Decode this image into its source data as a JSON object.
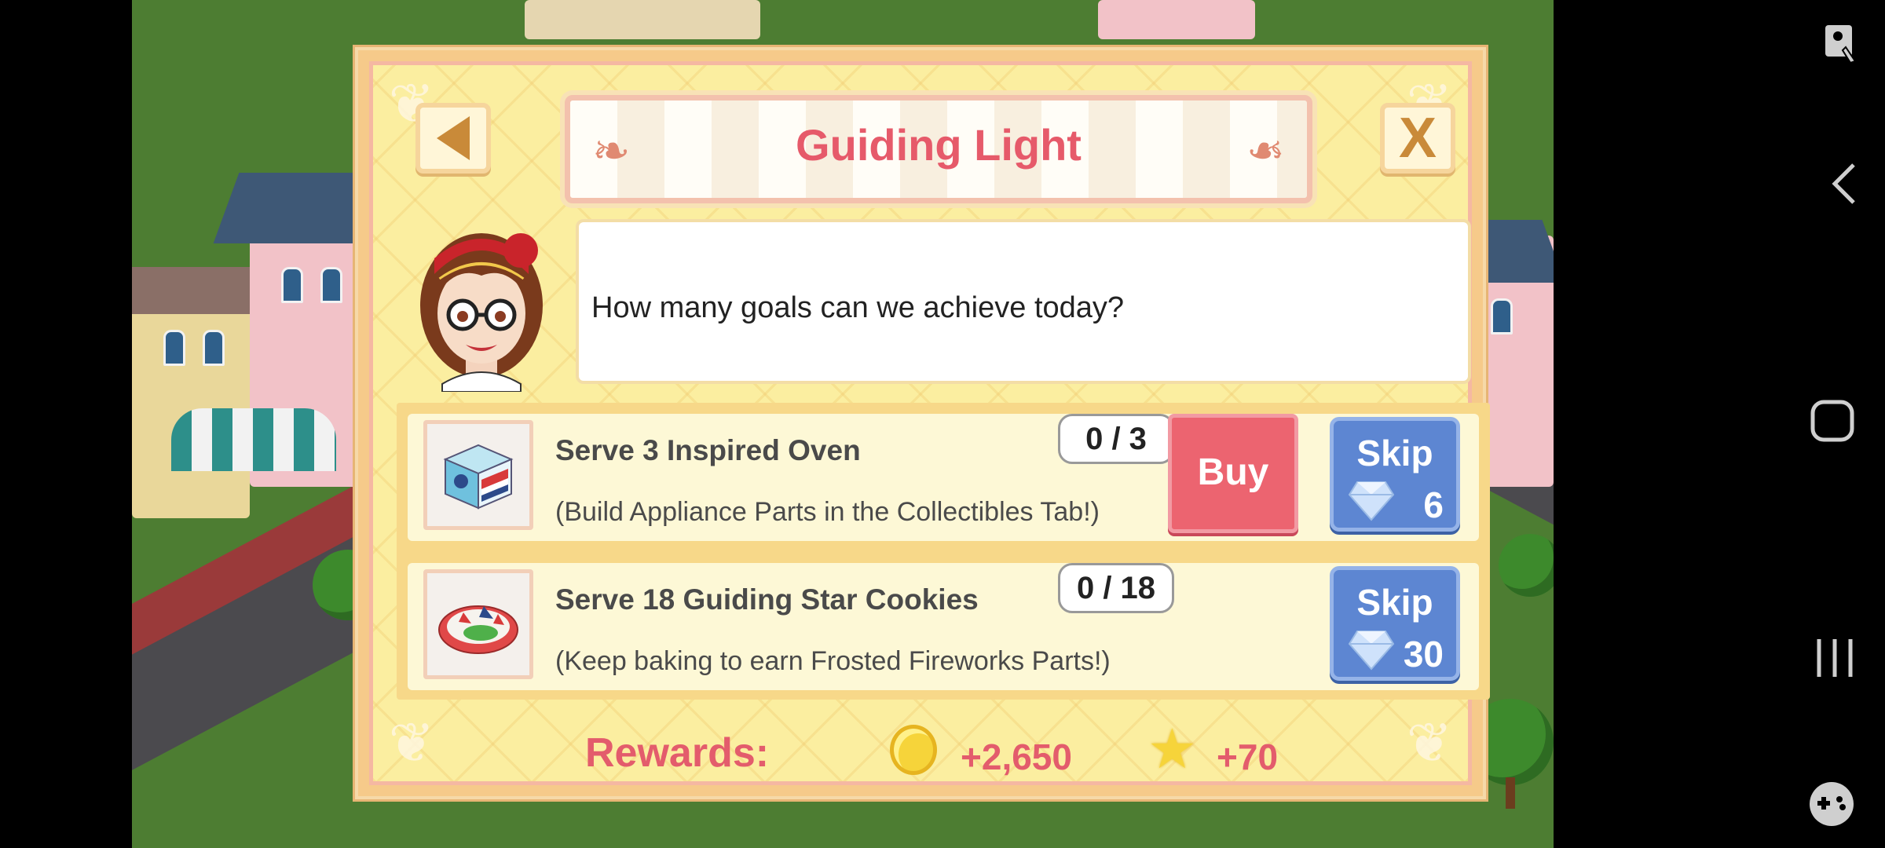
{
  "dialog": {
    "title": "Guiding Light",
    "speech": "How many goals can we achieve today?",
    "close_glyph": "X"
  },
  "goals": [
    {
      "title": "Serve 3 Inspired Oven",
      "description": "(Build Appliance Parts in the Collectibles Tab!)",
      "progress": "0 / 3",
      "buy_label": "Buy",
      "skip_label": "Skip",
      "skip_cost": "6",
      "icon": "oven-icon"
    },
    {
      "title": "Serve 18 Guiding Star Cookies",
      "description": "(Keep baking to earn Frosted Fireworks Parts!)",
      "progress": "0 / 18",
      "skip_label": "Skip",
      "skip_cost": "30",
      "icon": "cookies-plate-icon"
    }
  ],
  "rewards": {
    "label": "Rewards:",
    "coins": "+2,650",
    "xp": "+70"
  },
  "colors": {
    "title": "#e65a6a",
    "buy": "#ec6470",
    "skip": "#5d86d2",
    "panel": "#fbeea0"
  },
  "nav": {
    "icons": [
      "accessibility-icon",
      "back-icon",
      "home-icon",
      "recents-icon",
      "game-launcher-icon"
    ]
  }
}
